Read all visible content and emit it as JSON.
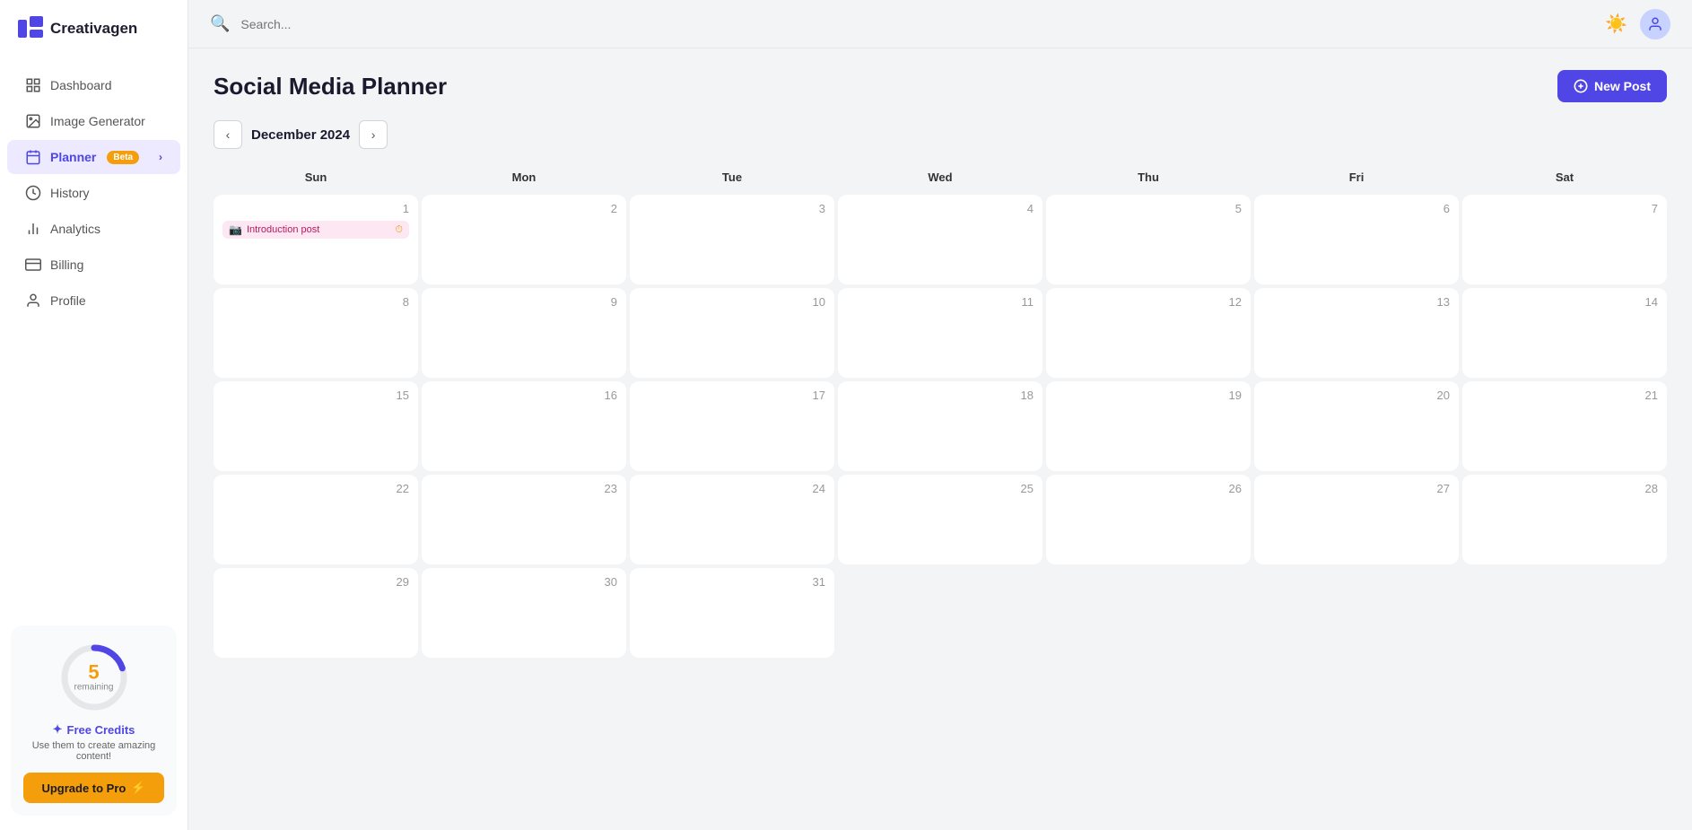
{
  "app": {
    "name": "Creativagen"
  },
  "sidebar": {
    "items": [
      {
        "id": "dashboard",
        "label": "Dashboard",
        "icon": "grid"
      },
      {
        "id": "image-generator",
        "label": "Image Generator",
        "icon": "image"
      },
      {
        "id": "planner",
        "label": "Planner",
        "icon": "calendar",
        "active": true,
        "badge": "Beta"
      },
      {
        "id": "history",
        "label": "History",
        "icon": "clock"
      },
      {
        "id": "analytics",
        "label": "Analytics",
        "icon": "bar-chart"
      },
      {
        "id": "billing",
        "label": "Billing",
        "icon": "credit-card"
      },
      {
        "id": "profile",
        "label": "Profile",
        "icon": "user"
      }
    ],
    "credits": {
      "remaining": 5,
      "label": "remaining",
      "title": "Free Credits",
      "description": "Use them to create amazing content!",
      "upgrade_label": "Upgrade to Pro"
    }
  },
  "topbar": {
    "search_placeholder": "Search..."
  },
  "page": {
    "title": "Social Media Planner",
    "new_post_label": "New Post"
  },
  "calendar": {
    "month": "December 2024",
    "days": [
      "Sun",
      "Mon",
      "Tue",
      "Wed",
      "Thu",
      "Fri",
      "Sat"
    ],
    "weeks": [
      [
        {
          "date": null,
          "empty": true
        },
        {
          "date": null,
          "empty": true
        },
        {
          "date": null,
          "empty": true
        },
        {
          "date": null,
          "empty": true
        },
        {
          "date": null,
          "empty": true
        },
        {
          "date": null,
          "empty": true
        },
        {
          "date": null,
          "empty": true
        }
      ]
    ],
    "cells": [
      {
        "day": 1,
        "events": [
          {
            "title": "Introduction post",
            "platform": "instagram"
          }
        ]
      },
      {
        "day": 2,
        "events": []
      },
      {
        "day": 3,
        "events": []
      },
      {
        "day": 4,
        "events": []
      },
      {
        "day": 5,
        "events": []
      },
      {
        "day": 6,
        "events": []
      },
      {
        "day": 7,
        "events": []
      },
      {
        "day": 8,
        "events": []
      },
      {
        "day": 9,
        "events": []
      },
      {
        "day": 10,
        "events": []
      },
      {
        "day": 11,
        "events": []
      },
      {
        "day": 12,
        "events": []
      },
      {
        "day": 13,
        "events": []
      },
      {
        "day": 14,
        "events": []
      },
      {
        "day": 15,
        "events": []
      },
      {
        "day": 16,
        "events": []
      },
      {
        "day": 17,
        "events": []
      },
      {
        "day": 18,
        "events": []
      },
      {
        "day": 19,
        "events": []
      },
      {
        "day": 20,
        "events": []
      },
      {
        "day": 21,
        "events": []
      },
      {
        "day": 22,
        "events": []
      },
      {
        "day": 23,
        "events": []
      },
      {
        "day": 24,
        "events": []
      },
      {
        "day": 25,
        "events": []
      },
      {
        "day": 26,
        "events": []
      },
      {
        "day": 27,
        "events": []
      },
      {
        "day": 28,
        "events": []
      },
      {
        "day": 29,
        "events": []
      },
      {
        "day": 30,
        "events": []
      },
      {
        "day": 31,
        "events": []
      }
    ]
  }
}
